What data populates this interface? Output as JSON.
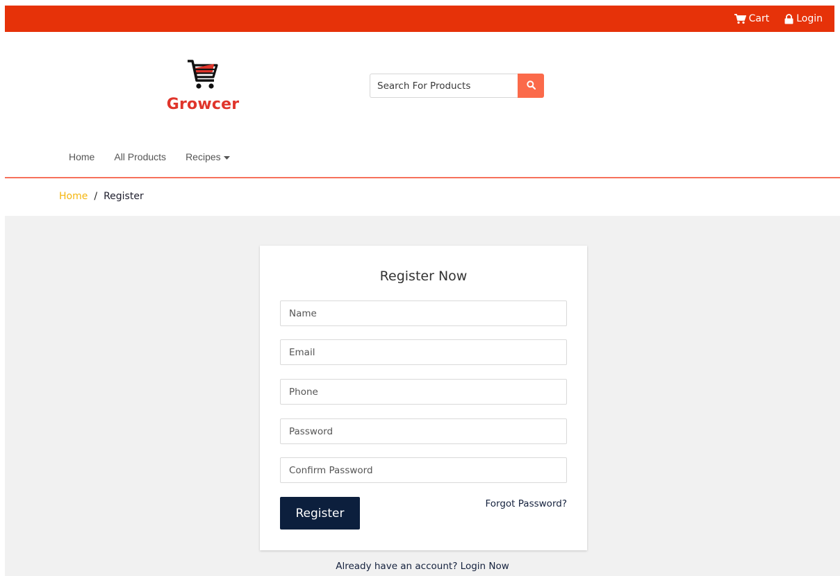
{
  "topbar": {
    "cart_label": "Cart",
    "login_label": "Login",
    "background": "#e63209"
  },
  "header": {
    "logo_text": "Growcer",
    "search": {
      "placeholder": "Search For Products",
      "value": ""
    }
  },
  "nav": {
    "items": [
      {
        "label": "Home"
      },
      {
        "label": "All Products"
      },
      {
        "label": "Recipes"
      }
    ]
  },
  "breadcrumb": {
    "home": "Home",
    "separator": "/",
    "current": "Register"
  },
  "form": {
    "title": "Register Now",
    "fields": {
      "name": {
        "placeholder": "Name",
        "value": ""
      },
      "email": {
        "placeholder": "Email",
        "value": ""
      },
      "phone": {
        "placeholder": "Phone",
        "value": ""
      },
      "password": {
        "placeholder": "Password",
        "value": ""
      },
      "confirm_password": {
        "placeholder": "Confirm Password",
        "value": ""
      }
    },
    "submit_label": "Register",
    "forgot_label": "Forgot Password?",
    "login_prompt": "Already have an account?",
    "login_link": "Login Now"
  },
  "colors": {
    "accent": "#e63209",
    "search_button": "#fb6a4a",
    "primary_button": "#0c1f3d",
    "breadcrumb_home": "#f5b60e",
    "logo": "#e0352b"
  },
  "icons": {
    "cart": "cart-icon",
    "lock": "lock-icon",
    "search": "search-icon",
    "dropdown": "caret-down-icon",
    "logo": "shopping-cart-logo-icon"
  }
}
